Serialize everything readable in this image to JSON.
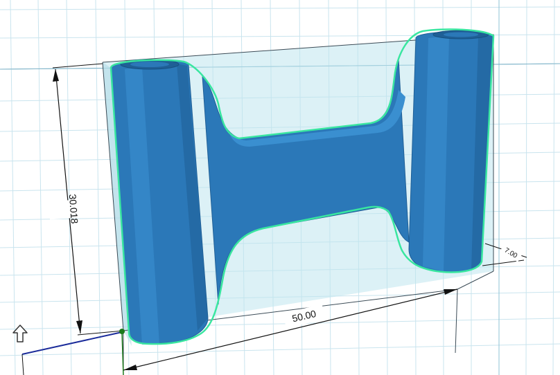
{
  "app": {
    "view": "3D modeling workspace"
  },
  "dimensions": {
    "height": "30.018",
    "width": "50.00",
    "depth": "7.00"
  },
  "colors": {
    "model": "#2b78b8",
    "model_dark": "#1f5f96",
    "model_light": "#3a8fd0",
    "selection_outline": "#39e6a0",
    "grid_minor": "#c9e4ee",
    "grid_major": "#8fc3d6",
    "bounding_box_fill": "#bfe6ef",
    "axis_x": "#1a2b9a",
    "axis_y": "#1b7a1b"
  },
  "icons": {
    "up_arrow": "up-arrow-icon"
  }
}
